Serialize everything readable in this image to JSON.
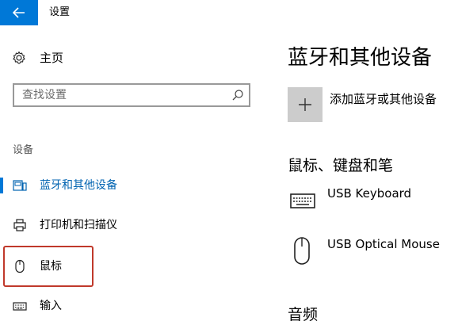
{
  "window": {
    "title": "设置"
  },
  "sidebar": {
    "home_label": "主页",
    "search": {
      "placeholder": "查找设置",
      "value": ""
    },
    "section_label": "设备",
    "items": [
      {
        "label": "蓝牙和其他设备",
        "icon": "bluetooth-devices-icon",
        "selected": true
      },
      {
        "label": "打印机和扫描仪",
        "icon": "printer-icon",
        "selected": false
      },
      {
        "label": "鼠标",
        "icon": "mouse-icon",
        "selected": false
      },
      {
        "label": "输入",
        "icon": "keyboard-icon",
        "selected": false
      }
    ]
  },
  "main": {
    "title": "蓝牙和其他设备",
    "add_device_label": "添加蓝牙或其他设备",
    "groups": [
      {
        "title": "鼠标、键盘和笔",
        "devices": [
          {
            "name": "USB Keyboard",
            "icon": "keyboard-icon"
          },
          {
            "name": "USB Optical Mouse",
            "icon": "mouse-icon"
          }
        ]
      },
      {
        "title": "音频"
      }
    ]
  },
  "colors": {
    "accent": "#0078d7",
    "selected_text": "#0063b1",
    "highlight": "#c0392b",
    "tile": "#cccccc"
  }
}
